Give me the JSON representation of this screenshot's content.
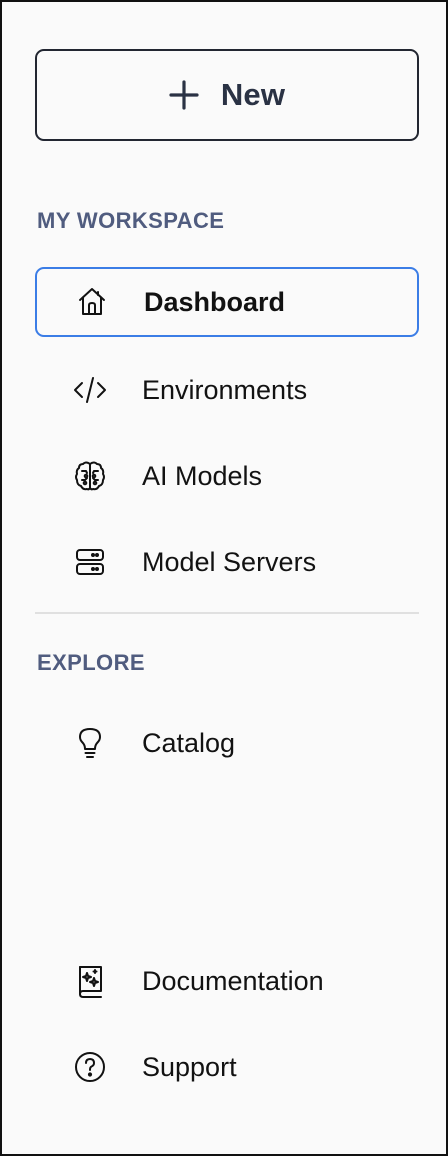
{
  "new_button": {
    "label": "New",
    "icon": "plus-icon"
  },
  "sections": {
    "workspace": {
      "title": "MY WORKSPACE"
    },
    "explore": {
      "title": "EXPLORE"
    }
  },
  "nav": {
    "dashboard": {
      "label": "Dashboard",
      "icon": "home-icon",
      "active": true
    },
    "environments": {
      "label": "Environments",
      "icon": "code-icon"
    },
    "ai_models": {
      "label": "AI Models",
      "icon": "brain-icon"
    },
    "model_servers": {
      "label": "Model Servers",
      "icon": "server-icon"
    },
    "catalog": {
      "label": "Catalog",
      "icon": "lightbulb-icon"
    },
    "documentation": {
      "label": "Documentation",
      "icon": "book-icon"
    },
    "support": {
      "label": "Support",
      "icon": "help-circle-icon"
    }
  },
  "colors": {
    "accent": "#3b7de6",
    "section_label": "#505c7f",
    "text": "#121212",
    "background": "#fafafa"
  }
}
